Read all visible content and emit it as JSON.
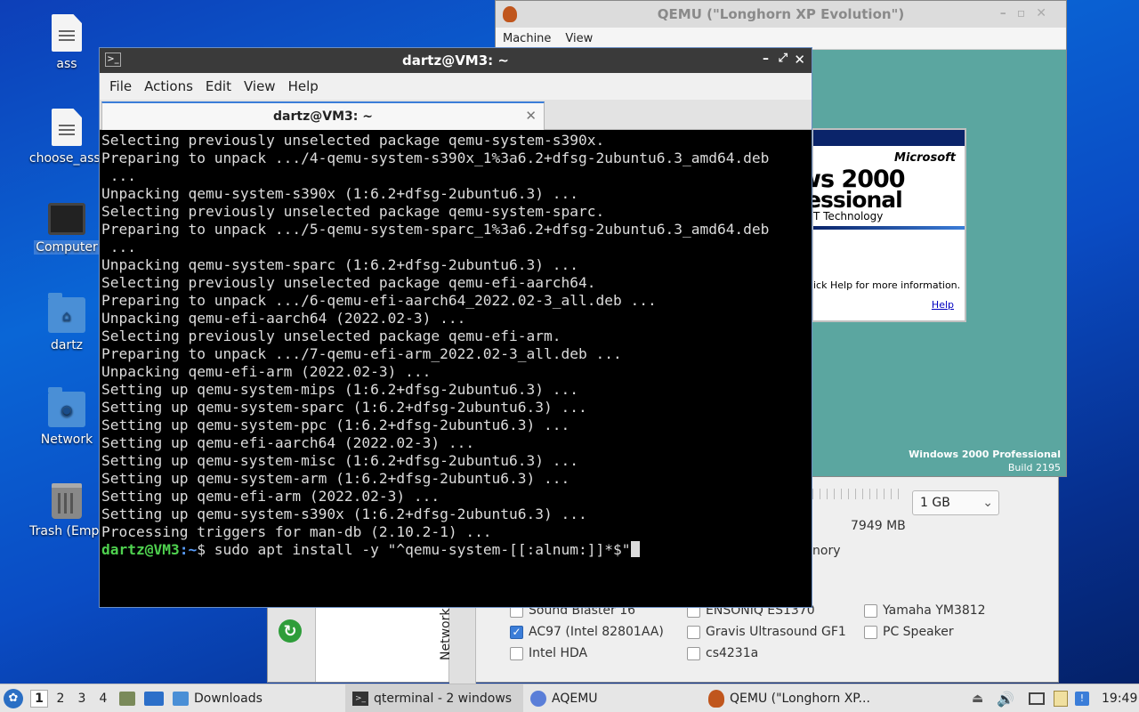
{
  "desktop": {
    "icons": [
      {
        "label": "ass"
      },
      {
        "label": "choose_ass."
      },
      {
        "label": "Computer"
      },
      {
        "label": "dartz"
      },
      {
        "label": "Network"
      },
      {
        "label": "Trash (Empt"
      }
    ]
  },
  "qemu_window": {
    "title": "QEMU (\"Longhorn XP Evolution\")",
    "menu": [
      "Machine",
      "View"
    ],
    "guest": {
      "brand": "Microsoft",
      "product_fragment_1": "ws 2000",
      "product_fragment_2": "essional",
      "tech_fragment": "T Technology",
      "help_text": "ick Help for more information.",
      "help_link": "Help",
      "watermark_line1": "Windows 2000 Professional",
      "watermark_line2": "Build 2195"
    }
  },
  "aqemu_window": {
    "memory_select": "1 GB",
    "memory_available": "7949 MB",
    "memory_label_fragment": "nory",
    "vertical_tab": "Network",
    "sound_cards": [
      {
        "label": "Sound Blaster 16",
        "checked": false
      },
      {
        "label": "ENSONIQ ES1370",
        "checked": false
      },
      {
        "label": "Yamaha YM3812",
        "checked": false
      },
      {
        "label": "AC97 (Intel 82801AA)",
        "checked": true
      },
      {
        "label": "Gravis Ultrasound GF1",
        "checked": false
      },
      {
        "label": "PC Speaker",
        "checked": false
      },
      {
        "label": "Intel HDA",
        "checked": false
      },
      {
        "label": "cs4231a",
        "checked": false
      }
    ]
  },
  "terminal": {
    "title": "dartz@VM3: ~",
    "menu": [
      "File",
      "Actions",
      "Edit",
      "View",
      "Help"
    ],
    "tab_label": "dartz@VM3: ~",
    "lines": [
      "Selecting previously unselected package qemu-system-s390x.",
      "Preparing to unpack .../4-qemu-system-s390x_1%3a6.2+dfsg-2ubuntu6.3_amd64.deb",
      " ...",
      "Unpacking qemu-system-s390x (1:6.2+dfsg-2ubuntu6.3) ...",
      "Selecting previously unselected package qemu-system-sparc.",
      "Preparing to unpack .../5-qemu-system-sparc_1%3a6.2+dfsg-2ubuntu6.3_amd64.deb",
      " ...",
      "Unpacking qemu-system-sparc (1:6.2+dfsg-2ubuntu6.3) ...",
      "Selecting previously unselected package qemu-efi-aarch64.",
      "Preparing to unpack .../6-qemu-efi-aarch64_2022.02-3_all.deb ...",
      "Unpacking qemu-efi-aarch64 (2022.02-3) ...",
      "Selecting previously unselected package qemu-efi-arm.",
      "Preparing to unpack .../7-qemu-efi-arm_2022.02-3_all.deb ...",
      "Unpacking qemu-efi-arm (2022.02-3) ...",
      "Setting up qemu-system-mips (1:6.2+dfsg-2ubuntu6.3) ...",
      "Setting up qemu-system-sparc (1:6.2+dfsg-2ubuntu6.3) ...",
      "Setting up qemu-system-ppc (1:6.2+dfsg-2ubuntu6.3) ...",
      "Setting up qemu-efi-aarch64 (2022.02-3) ...",
      "Setting up qemu-system-misc (1:6.2+dfsg-2ubuntu6.3) ...",
      "Setting up qemu-system-arm (1:6.2+dfsg-2ubuntu6.3) ...",
      "Setting up qemu-efi-arm (2022.02-3) ...",
      "Setting up qemu-system-s390x (1:6.2+dfsg-2ubuntu6.3) ...",
      "Processing triggers for man-db (2.10.2-1) ..."
    ],
    "prompt_user": "dartz@VM3",
    "prompt_path": ":~",
    "prompt_symbol": "$ ",
    "command": "sudo apt install -y \"^qemu-system-[[:alnum:]]*$\""
  },
  "taskbar": {
    "workspaces": [
      "1",
      "2",
      "3",
      "4"
    ],
    "downloads": "Downloads",
    "tasks": [
      {
        "label": "qterminal - 2 windows"
      },
      {
        "label": "AQEMU"
      },
      {
        "label": "QEMU (\"Longhorn XP..."
      }
    ],
    "clock": "19:49"
  }
}
